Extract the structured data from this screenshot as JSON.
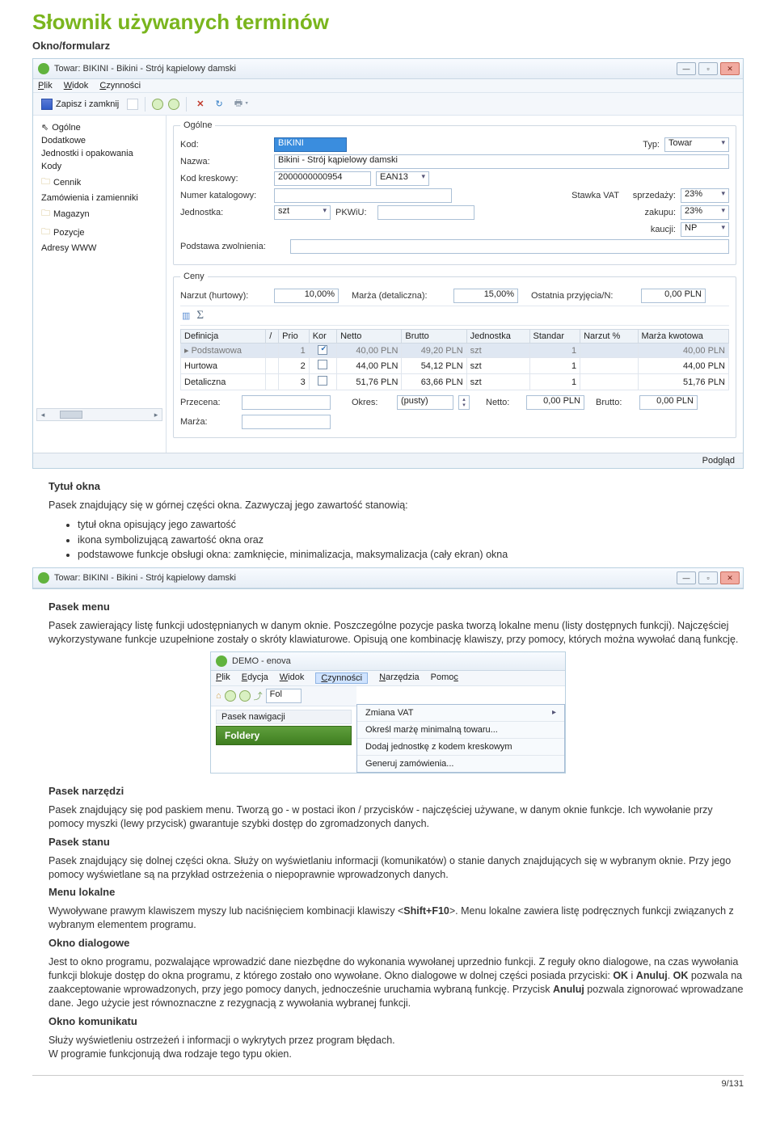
{
  "doc": {
    "title": "Słownik używanych terminów",
    "subtitle": "Okno/formularz",
    "section_tytul": "Tytuł okna",
    "tytul_text": "Pasek znajdujący się w górnej części okna. Zazwyczaj jego zawartość stanowią:",
    "bullets": [
      "tytuł okna opisujący jego zawartość",
      "ikona symbolizującą zawartość okna oraz",
      "podstawowe funkcje obsługi okna: zamknięcie, minimalizacja, maksymalizacja (cały ekran) okna"
    ],
    "section_pasek_menu": "Pasek menu",
    "pasek_menu_text": "Pasek zawierający listę funkcji udostępnianych w danym oknie. Poszczególne pozycje paska tworzą lokalne menu (listy dostępnych funkcji). Najczęściej wykorzystywane funkcje uzupełnione zostały o skróty klawiaturowe. Opisują one kombinację klawiszy, przy pomocy, których można wywołać daną funkcję.",
    "section_pasek_narzedzi": "Pasek narzędzi",
    "pasek_narzedzi_text": "Pasek znajdujący się pod paskiem menu. Tworzą go - w postaci ikon / przycisków - najczęściej używane, w danym oknie funkcje. Ich wywołanie przy pomocy myszki (lewy przycisk) gwarantuje szybki dostęp do zgromadzonych danych.",
    "section_pasek_stanu": "Pasek stanu",
    "pasek_stanu_text": "Pasek znajdujący się dolnej części okna. Służy on wyświetlaniu informacji (komunikatów) o stanie danych znajdujących się w wybranym oknie. Przy jego pomocy wyświetlane są na przykład ostrzeżenia o niepoprawnie wprowadzonych danych.",
    "section_menu_lokalne": "Menu lokalne",
    "menu_lokalne_pre": "Wywoływane prawym klawiszem myszy lub naciśnięciem kombinacji klawiszy <",
    "menu_lokalne_key": "Shift+F10",
    "menu_lokalne_post": ">. Menu lokalne zawiera listę podręcznych funkcji związanych z wybranym elementem programu.",
    "section_okno_dialogowe": "Okno dialogowe",
    "okno_dialogowe_pre": "Jest to okno programu, pozwalające wprowadzić dane niezbędne do wykonania wywołanej uprzednio funkcji. Z reguły okno dialogowe, na czas wywołania funkcji blokuje dostęp do okna programu, z którego zostało ono wywołane. Okno dialogowe w dolnej części posiada przyciski: ",
    "ok": "OK",
    "i": " i ",
    "anuluj": "Anuluj",
    "okno_dialogowe_mid1": ". ",
    "okno_dialogowe_mid2": " pozwala na zaakceptowanie wprowadzonych, przy jego pomocy danych, jednocześnie uruchamia wybraną funkcję. Przycisk ",
    "okno_dialogowe_post": " pozwala zignorować wprowadzane dane. Jego użycie jest równoznaczne z rezygnacją z wywołania wybranej funkcji.",
    "section_okno_komunikatu": "Okno komunikatu",
    "okno_komunikatu_text": "Służy wyświetleniu ostrzeżeń i informacji o wykrytych przez program błędach.\nW programie funkcjonują dwa rodzaje tego typu okien.",
    "footer": "9/131"
  },
  "win1": {
    "title": "Towar: BIKINI - Bikini - Strój kąpielowy damski",
    "menu": {
      "plik": "Plik",
      "widok": "Widok",
      "czynnosci": "Czynności"
    },
    "toolbar": {
      "save": "Zapisz i zamknij"
    },
    "nav": [
      "Ogólne",
      "Dodatkowe",
      "Jednostki i opakowania",
      "Kody",
      "Cennik",
      "Zamówienia i zamienniki",
      "Magazyn",
      "Pozycje",
      "Adresy WWW"
    ],
    "grp_ogolne": "Ogólne",
    "labels": {
      "kod": "Kod:",
      "typ": "Typ:",
      "nazwa": "Nazwa:",
      "kod_kreskowy": "Kod kreskowy:",
      "numer_kat": "Numer katalogowy:",
      "jednostka": "Jednostka:",
      "pkwiu": "PKWiU:",
      "stawka": "Stawka VAT",
      "sprzedazy": "sprzedaży:",
      "zakupu": "zakupu:",
      "kaucji": "kaucji:",
      "podstawa": "Podstawa zwolnienia:"
    },
    "vals": {
      "kod": "BIKINI",
      "typ": "Towar",
      "nazwa": "Bikini - Strój kąpielowy damski",
      "kreskowy": "2000000000954",
      "ean": "EAN13",
      "szt": "szt",
      "sprzed": "23%",
      "zakupu": "23%",
      "kaucji": "NP"
    },
    "grp_ceny": "Ceny",
    "ceny": {
      "narzut_l": "Narzut (hurtowy):",
      "narzut_v": "10,00%",
      "marza_l": "Marża (detaliczna):",
      "marza_v": "15,00%",
      "ostatnia_l": "Ostatnia przyjęcia/N:",
      "ostatnia_v": "0,00 PLN"
    },
    "grid": {
      "headers": [
        "Definicja",
        "/",
        "Priorytet",
        "Kontrola",
        "Netto",
        "Brutto",
        "Jednostka",
        "Standardowa",
        "Narzut %",
        "Marża kwotowa"
      ],
      "headers_short": [
        "Definicja",
        "/",
        "Prio",
        "Kor",
        "Netto",
        "Brutto",
        "Jednostka",
        "Standar",
        "Narzut %",
        "Marża kwotowa"
      ],
      "rows": [
        {
          "def": "Podstawowa",
          "prio": "1",
          "kor": true,
          "netto": "40,00 PLN",
          "brutto": "49,20 PLN",
          "jed": "szt",
          "std": "1",
          "narzut": "",
          "marza": "40,00 PLN",
          "sel": true,
          "mark": "▸"
        },
        {
          "def": "Hurtowa",
          "prio": "2",
          "kor": false,
          "netto": "44,00 PLN",
          "brutto": "54,12 PLN",
          "jed": "szt",
          "std": "1",
          "narzut": "",
          "marza": "44,00 PLN"
        },
        {
          "def": "Detaliczna",
          "prio": "3",
          "kor": false,
          "netto": "51,76 PLN",
          "brutto": "63,66 PLN",
          "jed": "szt",
          "std": "1",
          "narzut": "",
          "marza": "51,76 PLN"
        }
      ]
    },
    "bottom": {
      "przecena_l": "Przecena:",
      "okres_l": "Okres:",
      "okres_v": "(pusty)",
      "netto_l": "Netto:",
      "netto_v": "0,00 PLN",
      "brutto_l": "Brutto:",
      "brutto_v": "0,00 PLN",
      "marza_l": "Marża:"
    },
    "podglad": "Podgląd"
  },
  "win3": {
    "title": "DEMO - enova",
    "menu": [
      "Plik",
      "Edycja",
      "Widok",
      "Czynności",
      "Narzędzia",
      "Pomoc"
    ],
    "btn_fol": "Fol",
    "nav_label": "Pasek nawigacji",
    "foldery": "Foldery",
    "items": [
      "Zmiana VAT",
      "Określ marżę minimalną towaru...",
      "Dodaj jednostkę z kodem kreskowym",
      "Generuj zamówienia..."
    ]
  }
}
